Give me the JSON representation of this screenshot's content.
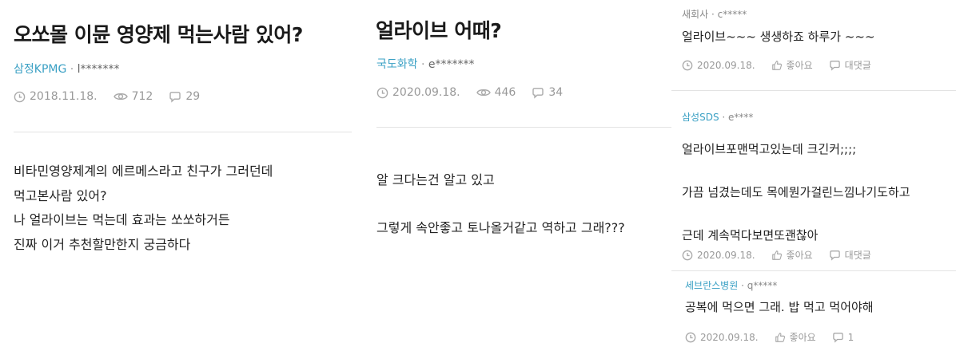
{
  "posts": [
    {
      "title": "오쏘몰 이뮨 영양제 먹는사람 있어?",
      "company": "삼정KPMG",
      "separator": "·",
      "user": "l*******",
      "date": "2018.11.18.",
      "views": "712",
      "comments": "29",
      "body": [
        "비타민영양제계의 에르메스라고 친구가 그러던데",
        "먹고본사람 있어?",
        "나 얼라이브는 먹는데 효과는 쏘쏘하거든",
        "진짜 이거 추천할만한지 궁금하다"
      ]
    },
    {
      "title": "얼라이브 어때?",
      "company": "국도화학",
      "separator": "·",
      "user": "e*******",
      "date": "2020.09.18.",
      "views": "446",
      "comments": "34",
      "body": [
        "알 크다는건 알고 있고",
        "그렇게 속안좋고 토나올거같고 역하고 그래???"
      ]
    }
  ],
  "comments": [
    {
      "company": "새회사",
      "separator": "·",
      "user": "c*****",
      "lines": [
        "얼라이브~~~ 생생하죠 하루가 ~~~"
      ],
      "date": "2020.09.18.",
      "like_label": "좋아요",
      "reply_label": "대댓글"
    },
    {
      "company": "삼성SDS",
      "separator": "·",
      "user": "e****",
      "lines": [
        "얼라이브포맨먹고있는데 크긴커;;;;",
        "가끔 넘겼는데도 목에뭔가걸린느낌나기도하고",
        "근데 계속먹다보면또괜찮아"
      ],
      "date": "2020.09.18.",
      "like_label": "좋아요",
      "reply_label": "대댓글"
    },
    {
      "company": "세브란스병원",
      "separator": "·",
      "user": "q*****",
      "lines": [
        "공복에 먹으면 그래. 밥 먹고 먹어야해"
      ],
      "date": "2020.09.18.",
      "like_label": "좋아요",
      "reply_label": "1"
    }
  ],
  "colors": {
    "company": "#3aa0c4",
    "meta": "#999999",
    "text": "#222222",
    "divider": "#e3e3e3"
  },
  "icons": {
    "date": "clock-icon",
    "views": "eye-icon",
    "comments": "speech-bubble-icon",
    "like": "thumbs-up-icon"
  }
}
